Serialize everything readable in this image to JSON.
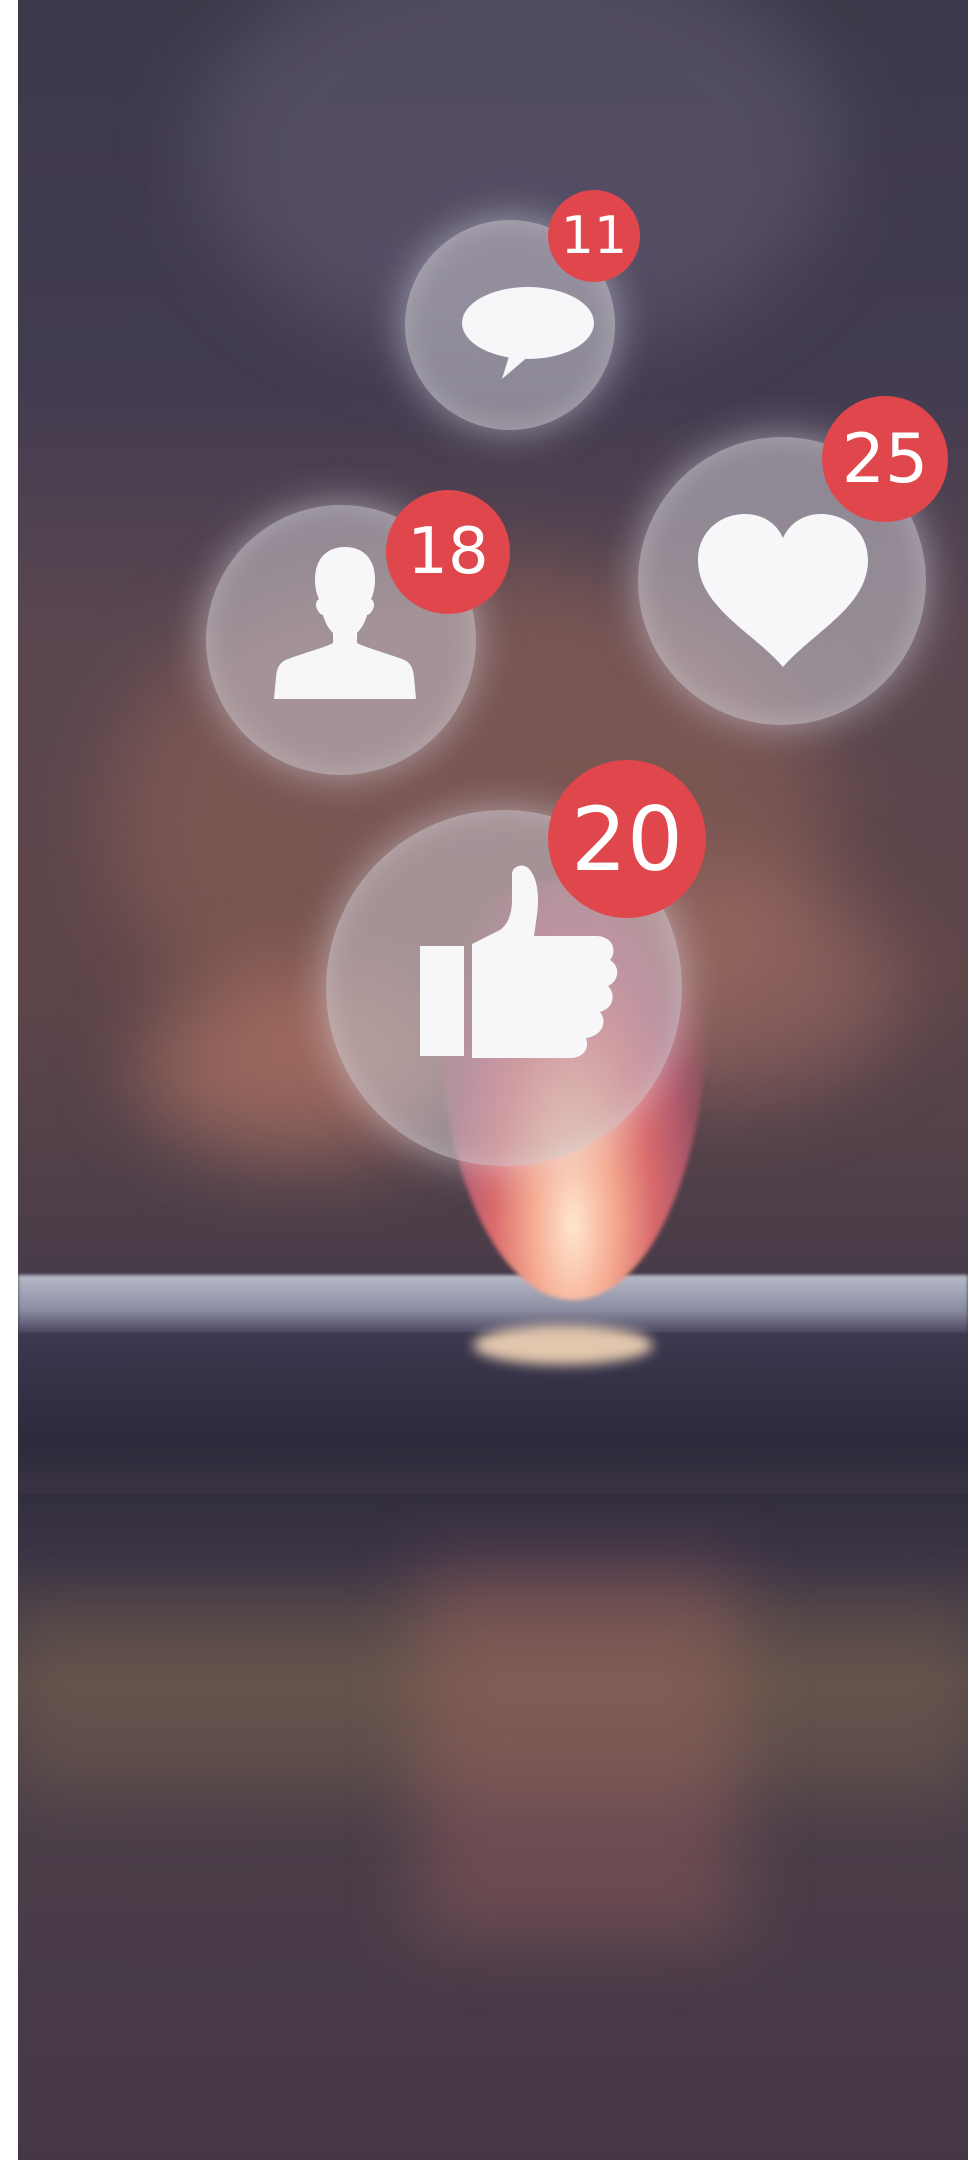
{
  "scene": {
    "notifications": {
      "comments": {
        "icon": "speech-bubble-icon",
        "count": "11"
      },
      "loves": {
        "icon": "heart-icon",
        "count": "25"
      },
      "followers": {
        "icon": "person-icon",
        "count": "18"
      },
      "likes": {
        "icon": "thumbs-up-icon",
        "count": "20"
      }
    },
    "colors": {
      "badge": "#e0474c",
      "bubble": "#c8c4cd",
      "icon": "#f7f7f9",
      "background": "#3d394a"
    }
  }
}
